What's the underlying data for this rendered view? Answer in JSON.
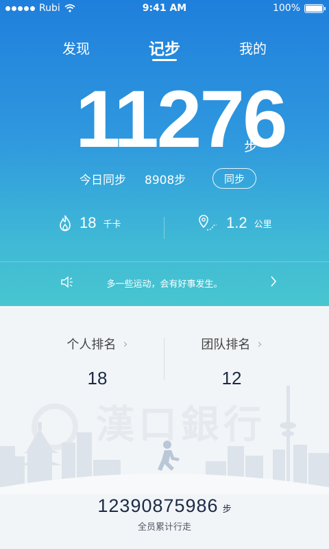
{
  "status": {
    "carrier": "Rubi",
    "time": "9:41 AM",
    "battery": "100%"
  },
  "tabs": [
    {
      "label": "发现"
    },
    {
      "label": "记步"
    },
    {
      "label": "我的"
    }
  ],
  "steps": {
    "count": "11276",
    "unit": "步"
  },
  "sync": {
    "label": "今日同步",
    "value": "8908步",
    "button": "同步"
  },
  "stats": {
    "calories": {
      "value": "18",
      "unit": "千卡"
    },
    "distance": {
      "value": "1.2",
      "unit": "公里"
    }
  },
  "notice": {
    "text": "多一些运动，会有好事发生。"
  },
  "ranking": {
    "personal": {
      "label": "个人排名",
      "value": "18"
    },
    "team": {
      "label": "团队排名",
      "value": "12"
    }
  },
  "watermark": "漢口銀行",
  "footer": {
    "total": "12390875986",
    "unit": "步",
    "label": "全员累计行走"
  },
  "colors": {
    "hero_top": "#1f7fdc",
    "hero_bottom": "#48c6cf",
    "text_dark": "#1c2a44"
  }
}
